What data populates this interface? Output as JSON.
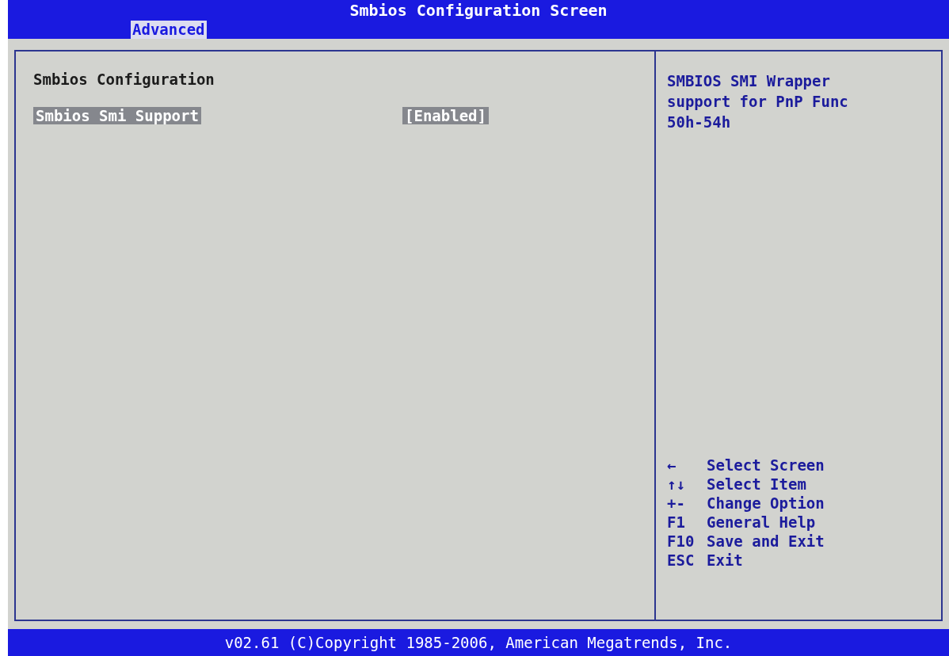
{
  "window": {
    "title": "Smbios Configuration Screen"
  },
  "tabs": [
    {
      "label": "Advanced",
      "selected": true
    }
  ],
  "section_title": "Smbios Configuration",
  "settings": [
    {
      "label": "Smbios Smi Support",
      "value": "[Enabled]",
      "selected": true
    }
  ],
  "help_text": "SMBIOS SMI Wrapper support for PnP Func 50h-54h",
  "key_legend": [
    {
      "key": "←",
      "action": "Select Screen"
    },
    {
      "key": "↑↓",
      "action": "Select Item"
    },
    {
      "key": "+-",
      "action": "Change Option"
    },
    {
      "key": "F1",
      "action": "General Help"
    },
    {
      "key": "F10",
      "action": "Save and Exit"
    },
    {
      "key": "ESC",
      "action": "Exit"
    }
  ],
  "status_bar": "v02.61 (C)Copyright 1985-2006, American Megatrends, Inc."
}
